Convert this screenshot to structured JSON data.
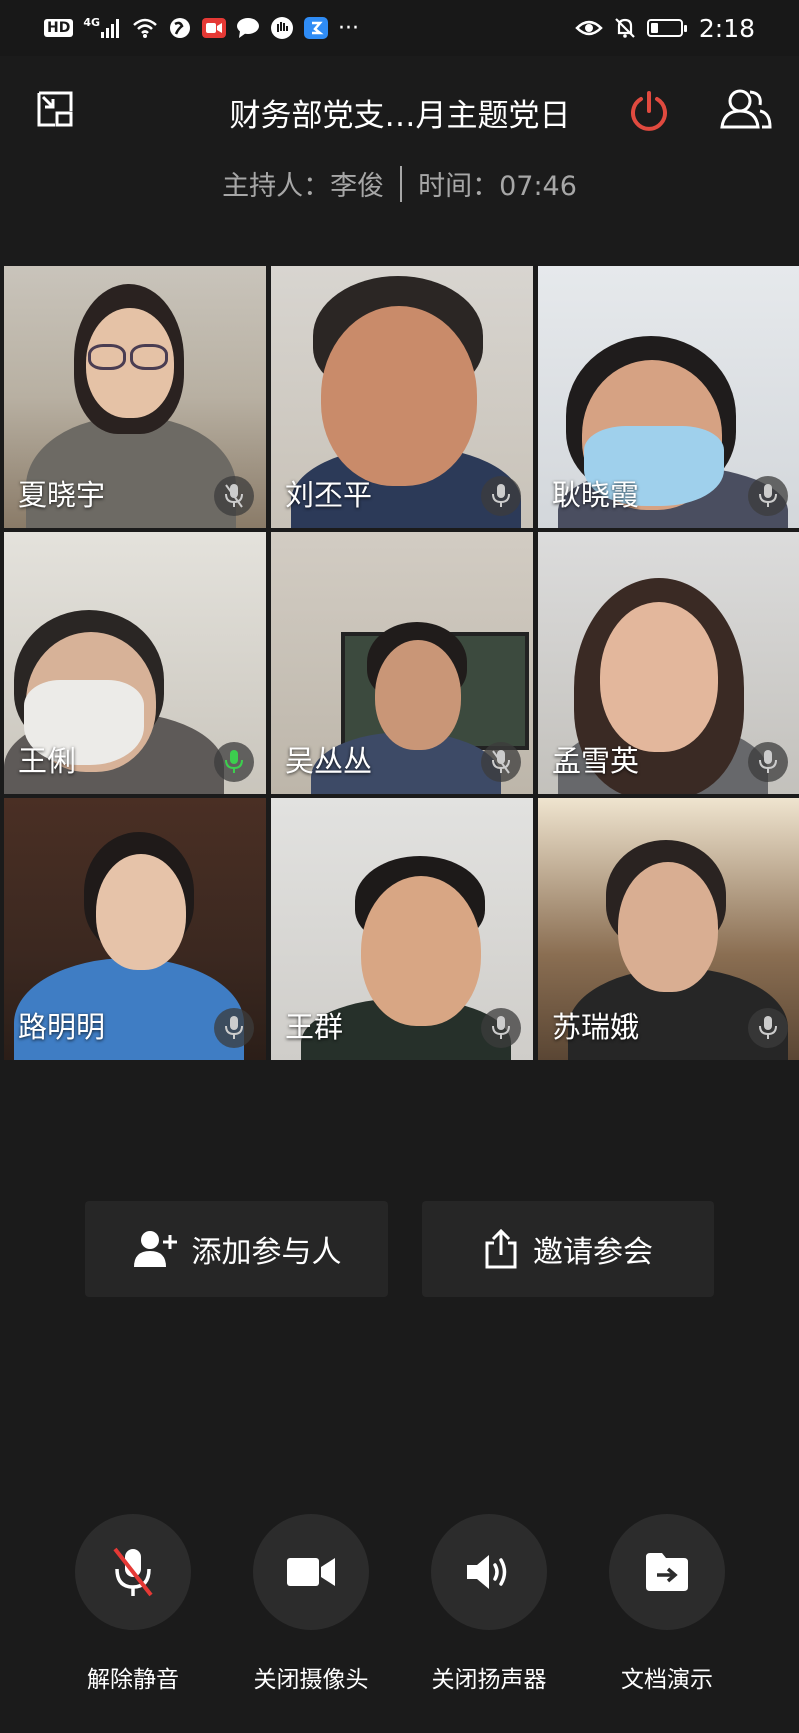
{
  "status_bar": {
    "hd": "HD",
    "network": "4G",
    "more": "···",
    "time": "2:18",
    "battery_level": 0.25
  },
  "header": {
    "title": "财务部党支…月主题党日",
    "host_label": "主持人：李俊",
    "time_label": "时间：07:46"
  },
  "participants": [
    {
      "name": "夏晓宇",
      "mic": "muted"
    },
    {
      "name": "刘丕平",
      "mic": "on"
    },
    {
      "name": "耿晓霞",
      "mic": "on"
    },
    {
      "name": "王俐",
      "mic": "speaking"
    },
    {
      "name": "吴丛丛",
      "mic": "muted"
    },
    {
      "name": "孟雪英",
      "mic": "on"
    },
    {
      "name": "路明明",
      "mic": "on"
    },
    {
      "name": "王群",
      "mic": "on"
    },
    {
      "name": "苏瑞娥",
      "mic": "on"
    }
  ],
  "actions": {
    "add_participant": "添加参与人",
    "invite": "邀请参会"
  },
  "controls": [
    {
      "label": "解除静音",
      "icon": "mic-muted-icon"
    },
    {
      "label": "关闭摄像头",
      "icon": "camera-icon"
    },
    {
      "label": "关闭扬声器",
      "icon": "speaker-icon"
    },
    {
      "label": "文档演示",
      "icon": "share-document-icon"
    }
  ],
  "colors": {
    "background": "#1b1b1b",
    "leave_red": "#e04a3f",
    "speaking_green": "#3ccf4e",
    "muted_slash": "#e53935"
  }
}
